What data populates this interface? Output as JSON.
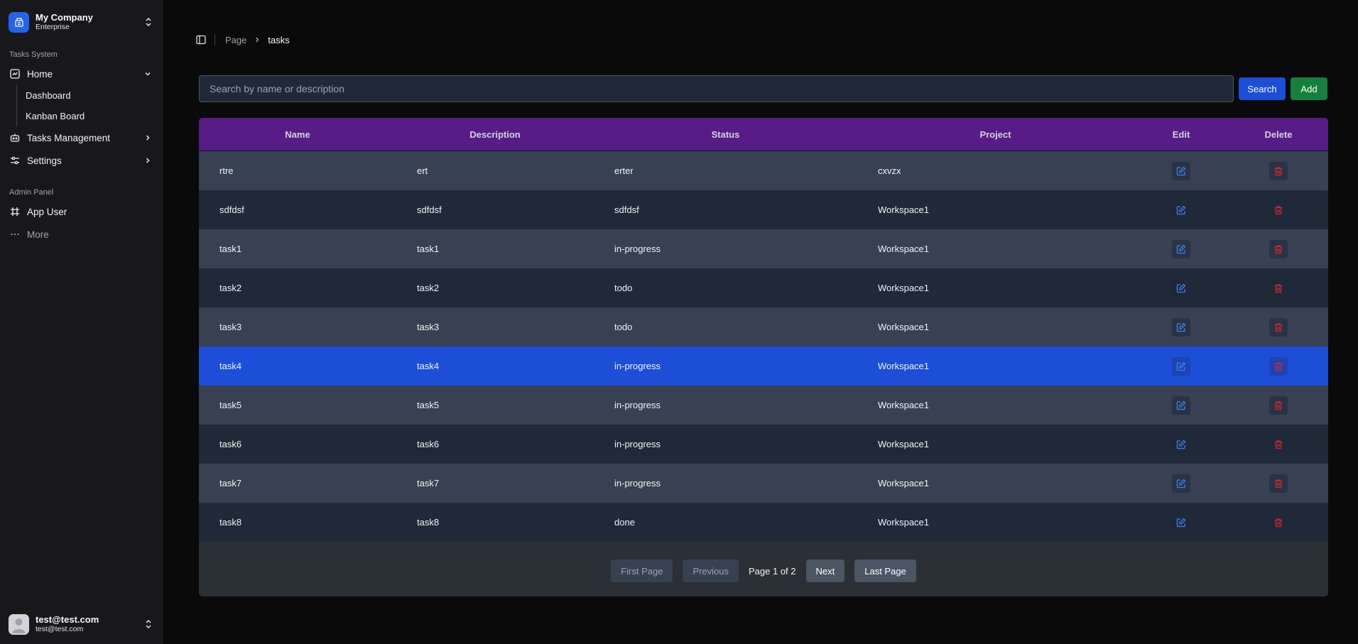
{
  "sidebar": {
    "company_name": "My Company",
    "company_plan": "Enterprise",
    "group1_label": "Tasks System",
    "home_label": "Home",
    "home_sub": [
      "Dashboard",
      "Kanban Board"
    ],
    "tasks_mgmt_label": "Tasks Management",
    "settings_label": "Settings",
    "group2_label": "Admin Panel",
    "app_user_label": "App User",
    "more_label": "More",
    "user_name": "test@test.com",
    "user_email": "test@test.com"
  },
  "breadcrumb": {
    "parent": "Page",
    "current": "tasks"
  },
  "search": {
    "placeholder": "Search by name or description",
    "value": "",
    "search_label": "Search",
    "add_label": "Add"
  },
  "table": {
    "columns": [
      "Name",
      "Description",
      "Status",
      "Project",
      "Edit",
      "Delete"
    ],
    "rows": [
      [
        "rtre",
        "ert",
        "erter",
        "cxvzx"
      ],
      [
        "sdfdsf",
        "sdfdsf",
        "sdfdsf",
        "Workspace1"
      ],
      [
        "task1",
        "task1",
        "in-progress",
        "Workspace1"
      ],
      [
        "task2",
        "task2",
        "todo",
        "Workspace1"
      ],
      [
        "task3",
        "task3",
        "todo",
        "Workspace1"
      ],
      [
        "task4",
        "task4",
        "in-progress",
        "Workspace1"
      ],
      [
        "task5",
        "task5",
        "in-progress",
        "Workspace1"
      ],
      [
        "task6",
        "task6",
        "in-progress",
        "Workspace1"
      ],
      [
        "task7",
        "task7",
        "in-progress",
        "Workspace1"
      ],
      [
        "task8",
        "task8",
        "done",
        "Workspace1"
      ]
    ],
    "selected_row": 5
  },
  "pagination": {
    "first": "First Page",
    "previous": "Previous",
    "status": "Page 1 of 2",
    "next": "Next",
    "last": "Last Page"
  },
  "colors": {
    "header": "#581c87",
    "selected_row": "#1d4ed8",
    "edit_icon": "#3b82f6",
    "delete_icon": "#dc2626",
    "search_button": "#1d4ed8",
    "add_button": "#15803d"
  },
  "icons": {
    "company": "building-icon",
    "home": "home-icon",
    "tasks_mgmt": "bot-icon",
    "settings": "sliders-icon",
    "app_user": "frame-icon",
    "more": "more-icon",
    "edit": "edit-icon",
    "delete": "trash-icon"
  }
}
